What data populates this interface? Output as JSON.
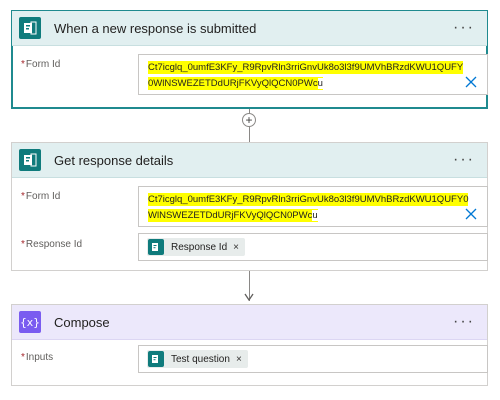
{
  "steps": [
    {
      "title": "When a new response is submitted",
      "fields": [
        {
          "label": "Form Id",
          "value_line1": "Ct7icglq_0umfE3KFy_R9RpvRln3rriGnvUk8o3l3f9UMVhBRzdKWU1QUFY",
          "value_line2_highlight": "0WlNSWEZETDdURjFKVyQlQCN0PWc",
          "value_line2_tail": "u"
        }
      ]
    },
    {
      "title": "Get response details",
      "fields": [
        {
          "label": "Form Id",
          "value_line1": "Ct7icglq_0umfE3KFy_R9RpvRln3rriGnvUk8o3l3f9UMVhBRzdKWU1QUFY0",
          "value_line2_highlight": "WlNSWEZETDdURjFKVyQlQCN0PWc",
          "value_line2_tail": "u"
        },
        {
          "label": "Response Id",
          "token": "Response Id"
        }
      ]
    },
    {
      "title": "Compose",
      "fields": [
        {
          "label": "Inputs",
          "token": "Test question"
        }
      ]
    }
  ],
  "required_marker": "*",
  "more_glyph": "···",
  "add_glyph": "+",
  "token_remove_glyph": "×",
  "compose_icon_glyph": "{x}",
  "colors": {
    "forms_teal": "#0f7b7c",
    "compose_purple": "#7a5cf0",
    "highlight": "#ffff00",
    "clear_blue": "#0078d4"
  }
}
